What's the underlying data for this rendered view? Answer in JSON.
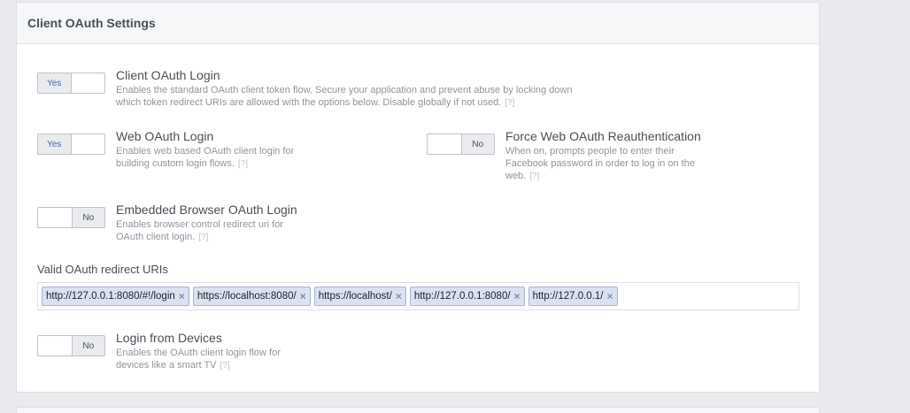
{
  "panel": {
    "title": "Client OAuth Settings"
  },
  "settings": {
    "client_oauth": {
      "toggle": "Yes",
      "title": "Client OAuth Login",
      "desc_line1": "Enables the standard OAuth client token flow. Secure your application and prevent abuse by locking down",
      "desc_line2": "which token redirect URIs are allowed with the options below. Disable globally if not used.",
      "help": "[?]"
    },
    "web_oauth": {
      "toggle": "Yes",
      "title": "Web OAuth Login",
      "desc_line1": "Enables web based OAuth client login for",
      "desc_line2": "building custom login flows.",
      "help": "[?]"
    },
    "force_web_oauth": {
      "toggle": "No",
      "title": "Force Web OAuth Reauthentication",
      "desc_line1": "When on, prompts people to enter their",
      "desc_line2": "Facebook password in order to log in on the",
      "desc_line3": "web.",
      "help": "[?]"
    },
    "embedded_browser": {
      "toggle": "No",
      "title": "Embedded Browser OAuth Login",
      "desc_line1": "Enables browser control redirect uri for",
      "desc_line2": "OAuth client login.",
      "help": "[?]"
    },
    "devices": {
      "toggle": "No",
      "title": "Login from Devices",
      "desc_line1": "Enables the OAuth client login flow for",
      "desc_line2": "devices like a smart TV",
      "help": "[?]"
    }
  },
  "redirect_uris": {
    "label": "Valid OAuth redirect URIs",
    "chips": [
      "http://127.0.0.1:8080/#!/login",
      "https://localhost:8080/",
      "https://localhost/",
      "http://127.0.0.1:8080/",
      "http://127.0.0.1/"
    ],
    "remove_glyph": "×"
  }
}
